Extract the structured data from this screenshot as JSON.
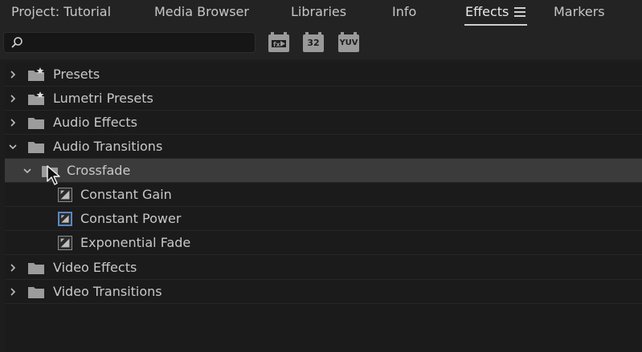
{
  "tabs": [
    {
      "label": "Project: Tutorial"
    },
    {
      "label": "Media Browser"
    },
    {
      "label": "Libraries"
    },
    {
      "label": "Info"
    },
    {
      "label": "Effects"
    },
    {
      "label": "Markers"
    }
  ],
  "active_tab": "Effects",
  "search": {
    "value": "",
    "placeholder": ""
  },
  "filter_buttons": [
    {
      "label": "",
      "icon": "accelerated-effects-icon"
    },
    {
      "label": "32",
      "icon": "32-bit-color-icon"
    },
    {
      "label": "YUV",
      "icon": "yuv-effects-icon"
    }
  ],
  "tree": [
    {
      "label": "Presets",
      "expanded": false,
      "icon": "preset-folder-icon"
    },
    {
      "label": "Lumetri Presets",
      "expanded": false,
      "icon": "preset-folder-icon"
    },
    {
      "label": "Audio Effects",
      "expanded": false,
      "icon": "folder-icon"
    },
    {
      "label": "Audio Transitions",
      "expanded": true,
      "icon": "folder-icon"
    },
    {
      "label": "Crossfade",
      "expanded": true,
      "icon": "folder-icon",
      "selected": true
    },
    {
      "label": "Constant Gain",
      "icon": "transition-effect-icon"
    },
    {
      "label": "Constant Power",
      "icon": "transition-effect-icon",
      "highlighted": true
    },
    {
      "label": "Exponential Fade",
      "icon": "transition-effect-icon"
    },
    {
      "label": "Video Effects",
      "expanded": false,
      "icon": "folder-icon"
    },
    {
      "label": "Video Transitions",
      "expanded": false,
      "icon": "folder-icon"
    }
  ],
  "colors": {
    "background": "#1d1d1d",
    "selected_row": "#3b3b3b",
    "highlight_border": "#5b86c6"
  }
}
